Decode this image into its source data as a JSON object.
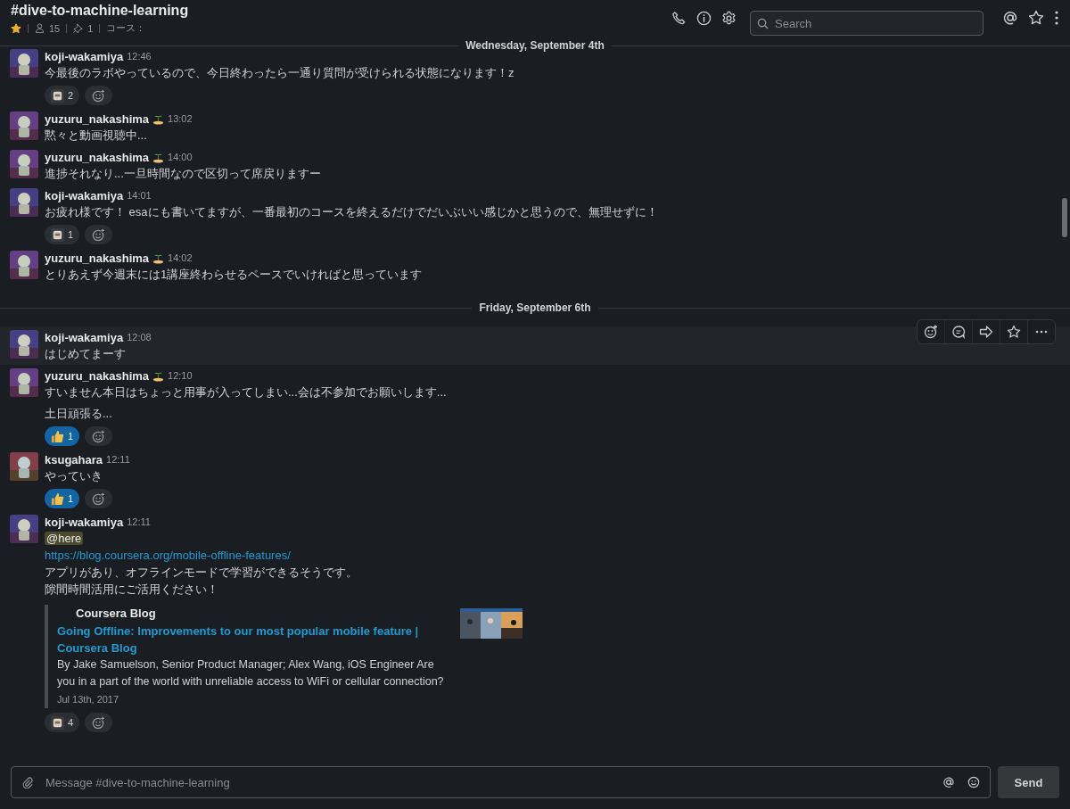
{
  "channel": {
    "title": "#dive-to-machine-learning",
    "starred": true,
    "members": "15",
    "pins": "1",
    "topic": "コース："
  },
  "search": {
    "placeholder": "Search"
  },
  "feed": [
    {
      "kind": "divider",
      "label": "Wednesday, September 4th"
    },
    {
      "kind": "message",
      "author": "koji-wakamiya",
      "status": false,
      "time": "12:46",
      "hovered": false,
      "lines": [
        {
          "kind": "text",
          "text": "今最後のラボやっているので、今日終わったら一通り質問が受けられる状態になります！z"
        }
      ],
      "reactions": [
        {
          "kind": "custom",
          "count": "2",
          "selected": false
        }
      ]
    },
    {
      "kind": "message",
      "author": "yuzuru_nakashima",
      "status": true,
      "time": "13:02",
      "hovered": false,
      "lines": [
        {
          "kind": "text",
          "text": "黙々と動画視聴中..."
        }
      ]
    },
    {
      "kind": "message",
      "author": "yuzuru_nakashima",
      "status": true,
      "time": "14:00",
      "hovered": false,
      "lines": [
        {
          "kind": "text",
          "text": "進捗それなり...一旦時間なので区切って席戻りますー"
        }
      ]
    },
    {
      "kind": "message",
      "author": "koji-wakamiya",
      "status": false,
      "time": "14:01",
      "hovered": false,
      "lines": [
        {
          "kind": "text",
          "text": "お疲れ様です！ esaにも書いてますが、一番最初のコースを終えるだけでだいぶいい感じかと思うので、無理せずに！"
        }
      ],
      "reactions": [
        {
          "kind": "custom",
          "count": "1",
          "selected": false
        }
      ]
    },
    {
      "kind": "message",
      "author": "yuzuru_nakashima",
      "status": true,
      "time": "14:02",
      "hovered": false,
      "lines": [
        {
          "kind": "text",
          "text": "とりあえず今週末には1講座終わらせるペースでいければと思っています"
        }
      ]
    },
    {
      "kind": "divider",
      "label": "Friday, September 6th"
    },
    {
      "kind": "message",
      "author": "koji-wakamiya",
      "status": false,
      "time": "12:08",
      "hovered": true,
      "lines": [
        {
          "kind": "text",
          "text": "はじめてまーす"
        }
      ]
    },
    {
      "kind": "message",
      "author": "yuzuru_nakashima",
      "status": true,
      "time": "12:10",
      "hovered": false,
      "lines": [
        {
          "kind": "text",
          "text": "すいません本日はちょっと用事が入ってしまい...会は不参加でお願いします..."
        },
        {
          "kind": "continuation",
          "text": "土日頑張る..."
        }
      ],
      "reactions": [
        {
          "kind": "thumbsup",
          "count": "1",
          "selected": true
        }
      ]
    },
    {
      "kind": "message",
      "author": "ksugahara",
      "status": false,
      "time": "12:11",
      "hovered": false,
      "lines": [
        {
          "kind": "text",
          "text": "やっていき"
        }
      ],
      "reactions": [
        {
          "kind": "thumbsup",
          "count": "1",
          "selected": true
        }
      ]
    },
    {
      "kind": "message",
      "author": "koji-wakamiya",
      "status": false,
      "time": "12:11",
      "hovered": false,
      "lines": [
        {
          "kind": "mention",
          "text": "@here"
        },
        {
          "kind": "link",
          "text": "https://blog.coursera.org/mobile-offline-features/"
        },
        {
          "kind": "text",
          "text": "アプリがあり、オフラインモードで学習ができるそうです。"
        },
        {
          "kind": "text",
          "text": "隙間時間活用にご活用ください！"
        }
      ],
      "attachment": {
        "site": "Coursera Blog",
        "title": "Going Offline: Improvements to our most popular mobile feature | Coursera Blog",
        "description": "By Jake Samuelson, Senior Product Manager; Alex Wang, iOS Engineer Are you in a part of the world with unreliable access to WiFi or cellular connection?",
        "date": "Jul 13th, 2017"
      },
      "reactions": [
        {
          "kind": "custom",
          "count": "4",
          "selected": false
        }
      ]
    }
  ],
  "composer": {
    "placeholder": "Message #dive-to-machine-learning",
    "send": "Send"
  }
}
